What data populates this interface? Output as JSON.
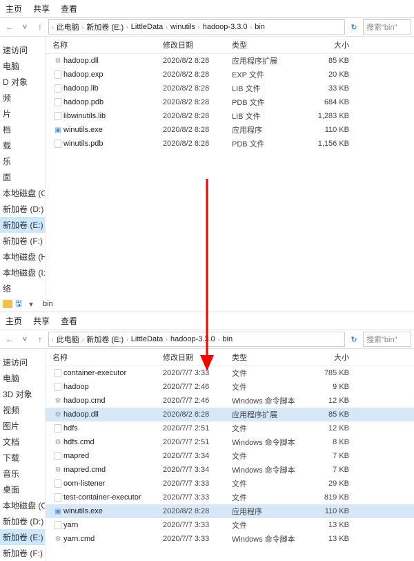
{
  "toolbar": {
    "menu_home": "主页",
    "menu_share": "共享",
    "menu_view": "查看"
  },
  "breadcrumb": {
    "items": [
      "此电脑",
      "新加卷 (E:)",
      "LittleData",
      "winutils",
      "hadoop-3.3.0",
      "bin"
    ]
  },
  "breadcrumb2": {
    "items": [
      "此电脑",
      "新加卷 (E:)",
      "LittleData",
      "hadoop-3.3.0",
      "bin"
    ]
  },
  "search": {
    "placeholder": "搜索\"bin\""
  },
  "columns": {
    "name": "名称",
    "date": "修改日期",
    "type": "类型",
    "size": "大小"
  },
  "sidebar1": {
    "items": [
      {
        "label": "速访问"
      },
      {
        "label": "电脑"
      },
      {
        "label": "D 对象"
      },
      {
        "label": "频"
      },
      {
        "label": "片"
      },
      {
        "label": "档"
      },
      {
        "label": "载"
      },
      {
        "label": "乐"
      },
      {
        "label": "面"
      },
      {
        "label": "本地磁盘 (C:)"
      },
      {
        "label": "新加卷 (D:)"
      },
      {
        "label": "新加卷 (E:)",
        "selected": true
      },
      {
        "label": "新加卷 (F:)"
      },
      {
        "label": "本地磁盘 (H:)"
      },
      {
        "label": "本地磁盘 (I:)"
      },
      {
        "label": "络"
      }
    ]
  },
  "sidebar2": {
    "items": [
      {
        "label": "速访问"
      },
      {
        "label": "电脑"
      },
      {
        "label": "3D 对象"
      },
      {
        "label": "视频"
      },
      {
        "label": "图片"
      },
      {
        "label": "文档"
      },
      {
        "label": "下载"
      },
      {
        "label": "音乐"
      },
      {
        "label": "桌面"
      },
      {
        "label": "本地磁盘 (C:)"
      },
      {
        "label": "新加卷 (D:)"
      },
      {
        "label": "新加卷 (E:)",
        "selected": true
      },
      {
        "label": "新加卷 (F:)"
      }
    ]
  },
  "files1": [
    {
      "icon": "dll",
      "name": "hadoop.dll",
      "date": "2020/8/2 8:28",
      "type": "应用程序扩展",
      "size": "85 KB"
    },
    {
      "icon": "file",
      "name": "hadoop.exp",
      "date": "2020/8/2 8:28",
      "type": "EXP 文件",
      "size": "20 KB"
    },
    {
      "icon": "file",
      "name": "hadoop.lib",
      "date": "2020/8/2 8:28",
      "type": "LIB 文件",
      "size": "33 KB"
    },
    {
      "icon": "file",
      "name": "hadoop.pdb",
      "date": "2020/8/2 8:28",
      "type": "PDB 文件",
      "size": "684 KB"
    },
    {
      "icon": "file",
      "name": "libwinutils.lib",
      "date": "2020/8/2 8:28",
      "type": "LIB 文件",
      "size": "1,283 KB"
    },
    {
      "icon": "exe",
      "name": "winutils.exe",
      "date": "2020/8/2 8:28",
      "type": "应用程序",
      "size": "110 KB"
    },
    {
      "icon": "file",
      "name": "winutils.pdb",
      "date": "2020/8/2 8:28",
      "type": "PDB 文件",
      "size": "1,156 KB"
    }
  ],
  "files2": [
    {
      "icon": "file",
      "name": "container-executor",
      "date": "2020/7/7 3:33",
      "type": "文件",
      "size": "785 KB"
    },
    {
      "icon": "file",
      "name": "hadoop",
      "date": "2020/7/7 2:46",
      "type": "文件",
      "size": "9 KB"
    },
    {
      "icon": "cmd",
      "name": "hadoop.cmd",
      "date": "2020/7/7 2:46",
      "type": "Windows 命令脚本",
      "size": "12 KB"
    },
    {
      "icon": "dll",
      "name": "hadoop.dll",
      "date": "2020/8/2 8:28",
      "type": "应用程序扩展",
      "size": "85 KB",
      "selected": true
    },
    {
      "icon": "file",
      "name": "hdfs",
      "date": "2020/7/7 2:51",
      "type": "文件",
      "size": "12 KB"
    },
    {
      "icon": "cmd",
      "name": "hdfs.cmd",
      "date": "2020/7/7 2:51",
      "type": "Windows 命令脚本",
      "size": "8 KB"
    },
    {
      "icon": "file",
      "name": "mapred",
      "date": "2020/7/7 3:34",
      "type": "文件",
      "size": "7 KB"
    },
    {
      "icon": "cmd",
      "name": "mapred.cmd",
      "date": "2020/7/7 3:34",
      "type": "Windows 命令脚本",
      "size": "7 KB"
    },
    {
      "icon": "file",
      "name": "oom-listener",
      "date": "2020/7/7 3:33",
      "type": "文件",
      "size": "29 KB"
    },
    {
      "icon": "file",
      "name": "test-container-executor",
      "date": "2020/7/7 3:33",
      "type": "文件",
      "size": "819 KB"
    },
    {
      "icon": "exe",
      "name": "winutils.exe",
      "date": "2020/8/2 8:28",
      "type": "应用程序",
      "size": "110 KB",
      "selected": true
    },
    {
      "icon": "file",
      "name": "yarn",
      "date": "2020/7/7 3:33",
      "type": "文件",
      "size": "13 KB"
    },
    {
      "icon": "cmd",
      "name": "yarn.cmd",
      "date": "2020/7/7 3:33",
      "type": "Windows 命令脚本",
      "size": "13 KB"
    }
  ],
  "titlebar_top": {
    "tab": ""
  },
  "titlebar_bottom": {
    "tab": "bin"
  }
}
